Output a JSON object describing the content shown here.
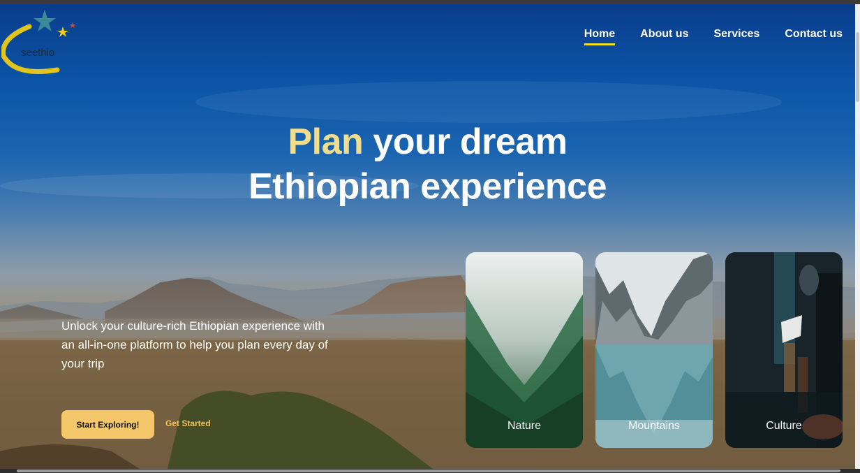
{
  "brand": {
    "logo_text": "seethio"
  },
  "nav": {
    "items": [
      {
        "label": "Home",
        "active": true
      },
      {
        "label": "About us",
        "active": false
      },
      {
        "label": "Services",
        "active": false
      },
      {
        "label": "Contact us",
        "active": false
      }
    ]
  },
  "hero": {
    "title_accent": "Plan",
    "title_rest_line1": " your dream",
    "title_line2": "Ethiopian experience",
    "description": "Unlock your culture-rich Ethiopian experience with an all-in-one platform to help you plan every day of your trip",
    "primary_button": "Start Exploring!",
    "secondary_link": "Get Started"
  },
  "cards": [
    {
      "label": "Nature"
    },
    {
      "label": "Mountains"
    },
    {
      "label": "Culture"
    }
  ],
  "colors": {
    "accent_yellow": "#f4c86a",
    "title_accent": "#f1dd8c",
    "nav_underline": "#f2e11c",
    "sky_blue": "#0c56a8"
  }
}
